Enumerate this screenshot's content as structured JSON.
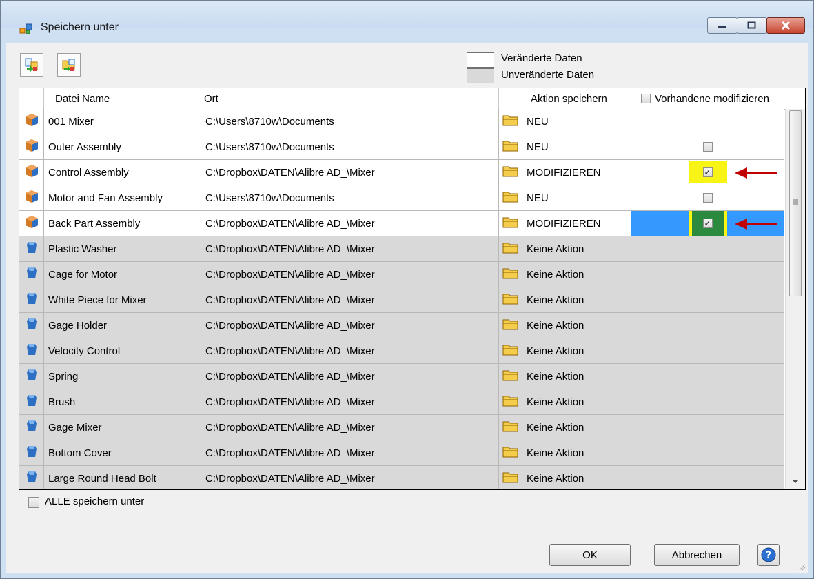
{
  "window": {
    "title": "Speichern unter"
  },
  "legend": {
    "changed": "Veränderte Daten",
    "unchanged": "Unveränderte Daten"
  },
  "columns": {
    "name": "Datei Name",
    "location": "Ort",
    "action": "Aktion speichern",
    "modify_existing": "Vorhandene modifizieren"
  },
  "rows": [
    {
      "name": "001 Mixer",
      "location": "C:\\Users\\8710w\\Documents",
      "action": "NEU",
      "state": "changed",
      "modify": "none",
      "icon": "assembly-icon"
    },
    {
      "name": "Outer Assembly",
      "location": "C:\\Users\\8710w\\Documents",
      "action": "NEU",
      "state": "changed",
      "modify": "unchecked",
      "icon": "assembly-icon"
    },
    {
      "name": "Control Assembly",
      "location": "C:\\Dropbox\\DATEN\\Alibre AD_\\Mixer",
      "action": "MODIFIZIEREN",
      "state": "changed",
      "modify": "checked",
      "icon": "assembly-icon"
    },
    {
      "name": "Motor and Fan Assembly",
      "location": "C:\\Users\\8710w\\Documents",
      "action": "NEU",
      "state": "changed",
      "modify": "unchecked",
      "icon": "assembly-icon"
    },
    {
      "name": "Back Part Assembly",
      "location": "C:\\Dropbox\\DATEN\\Alibre AD_\\Mixer",
      "action": "MODIFIZIEREN",
      "state": "changed",
      "modify": "checked",
      "selected": true,
      "icon": "assembly-icon"
    },
    {
      "name": "Plastic Washer",
      "location": "C:\\Dropbox\\DATEN\\Alibre AD_\\Mixer",
      "action": "Keine Aktion",
      "state": "unchanged",
      "modify": "none",
      "icon": "part-icon"
    },
    {
      "name": "Cage for Motor",
      "location": "C:\\Dropbox\\DATEN\\Alibre AD_\\Mixer",
      "action": "Keine Aktion",
      "state": "unchanged",
      "modify": "none",
      "icon": "part-icon"
    },
    {
      "name": "White Piece for Mixer",
      "location": "C:\\Dropbox\\DATEN\\Alibre AD_\\Mixer",
      "action": "Keine Aktion",
      "state": "unchanged",
      "modify": "none",
      "icon": "part-icon"
    },
    {
      "name": "Gage Holder",
      "location": "C:\\Dropbox\\DATEN\\Alibre AD_\\Mixer",
      "action": "Keine Aktion",
      "state": "unchanged",
      "modify": "none",
      "icon": "part-icon"
    },
    {
      "name": "Velocity Control",
      "location": "C:\\Dropbox\\DATEN\\Alibre AD_\\Mixer",
      "action": "Keine Aktion",
      "state": "unchanged",
      "modify": "none",
      "icon": "part-icon"
    },
    {
      "name": "Spring",
      "location": "C:\\Dropbox\\DATEN\\Alibre AD_\\Mixer",
      "action": "Keine Aktion",
      "state": "unchanged",
      "modify": "none",
      "icon": "part-icon"
    },
    {
      "name": "Brush",
      "location": "C:\\Dropbox\\DATEN\\Alibre AD_\\Mixer",
      "action": "Keine Aktion",
      "state": "unchanged",
      "modify": "none",
      "icon": "part-icon"
    },
    {
      "name": "Gage Mixer",
      "location": "C:\\Dropbox\\DATEN\\Alibre AD_\\Mixer",
      "action": "Keine Aktion",
      "state": "unchanged",
      "modify": "none",
      "icon": "part-icon"
    },
    {
      "name": "Bottom Cover",
      "location": "C:\\Dropbox\\DATEN\\Alibre AD_\\Mixer",
      "action": "Keine Aktion",
      "state": "unchanged",
      "modify": "none",
      "icon": "part-icon"
    },
    {
      "name": "Large Round Head Bolt",
      "location": "C:\\Dropbox\\DATEN\\Alibre AD_\\Mixer",
      "action": "Keine Aktion",
      "state": "unchanged",
      "modify": "none",
      "icon": "part-icon"
    }
  ],
  "footer": {
    "save_all_label": "ALLE speichern unter",
    "ok_label": "OK",
    "cancel_label": "Abbrechen"
  },
  "colors": {
    "changed_row": "#ffffff",
    "unchanged_row": "#d9d9d9",
    "selection": "#3399ff",
    "highlight": "#f8f516",
    "arrow": "#c00000"
  }
}
